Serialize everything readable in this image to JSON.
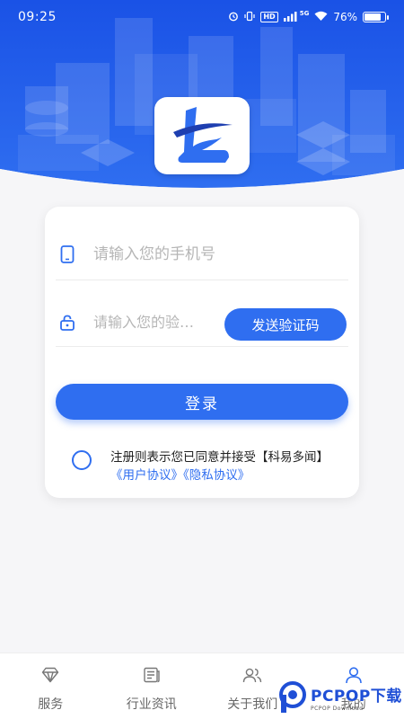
{
  "status_bar": {
    "time": "09:25",
    "network_badge": "HD",
    "signal_label": "5G",
    "battery_percent": "76%",
    "battery_level": 0.76
  },
  "colors": {
    "primary": "#2f6ef0",
    "hero_blue": "#1f5bea",
    "background": "#f6f6f8"
  },
  "login": {
    "phone_placeholder": "请输入您的手机号",
    "code_placeholder": "请输入您的验…",
    "send_code_label": "发送验证码",
    "login_label": "登录"
  },
  "agreement": {
    "text": "注册则表示您已同意并接受【科易多闻】",
    "user_agreement": "《用户协议》",
    "privacy_policy": "《隐私协议》"
  },
  "bottom_nav": {
    "items": [
      {
        "label": "服务",
        "icon": "diamond-icon"
      },
      {
        "label": "行业资讯",
        "icon": "news-icon"
      },
      {
        "label": "关于我们",
        "icon": "people-icon"
      },
      {
        "label": "我的",
        "icon": "user-icon"
      }
    ]
  },
  "watermark": {
    "main": "PCPOP下载",
    "sub": "PCPOP Download"
  }
}
